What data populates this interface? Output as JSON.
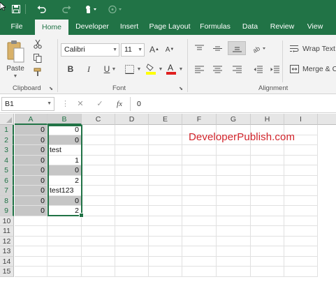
{
  "toolbar": {
    "save_icon": "save-icon",
    "undo_icon": "undo-icon",
    "redo_icon": "redo-icon",
    "touch_mode_icon": "touch-mode-icon",
    "customize_icon": "customize-qat-icon"
  },
  "tabs": [
    "File",
    "Home",
    "Developer",
    "Insert",
    "Page Layout",
    "Formulas",
    "Data",
    "Review",
    "View"
  ],
  "active_tab": "Home",
  "ribbon": {
    "clipboard": {
      "paste_label": "Paste",
      "group_label": "Clipboard"
    },
    "font": {
      "font_name": "Calibri",
      "font_size": "11",
      "bold": "B",
      "italic": "I",
      "underline": "U",
      "group_label": "Font"
    },
    "alignment": {
      "wrap_text": "Wrap Text",
      "merge_center": "Merge & C",
      "group_label": "Alignment"
    }
  },
  "formula_bar": {
    "name_box": "B1",
    "cancel_symbol": "✕",
    "enter_symbol": "✓",
    "fx_label": "fx",
    "formula_value": "0"
  },
  "grid": {
    "columns": [
      "A",
      "B",
      "C",
      "D",
      "E",
      "F",
      "G",
      "H",
      "I"
    ],
    "selected_columns": [
      "A",
      "B"
    ],
    "rows": [
      "1",
      "2",
      "3",
      "4",
      "5",
      "6",
      "7",
      "8",
      "9",
      "10",
      "11",
      "12",
      "13",
      "14",
      "15"
    ],
    "selected_rows": [
      "1",
      "2",
      "3",
      "4",
      "5",
      "6",
      "7",
      "8",
      "9"
    ],
    "cells": [
      {
        "a": "0",
        "b": "0",
        "b_num": true,
        "b_shaded": false
      },
      {
        "a": "0",
        "b": "0",
        "b_num": true,
        "b_shaded": true
      },
      {
        "a": "0",
        "b": "test",
        "b_num": false,
        "b_shaded": false
      },
      {
        "a": "0",
        "b": "1",
        "b_num": true,
        "b_shaded": false
      },
      {
        "a": "0",
        "b": "0",
        "b_num": true,
        "b_shaded": true
      },
      {
        "a": "0",
        "b": "2",
        "b_num": true,
        "b_shaded": false
      },
      {
        "a": "0",
        "b": "test123",
        "b_num": false,
        "b_shaded": false
      },
      {
        "a": "0",
        "b": "0",
        "b_num": true,
        "b_shaded": true
      },
      {
        "a": "0",
        "b": "2",
        "b_num": true,
        "b_shaded": false
      }
    ]
  },
  "watermark": "DeveloperPublish.com",
  "colors": {
    "accent": "#217346",
    "watermark": "#d2232a",
    "selection_shade": "#c6c6c6"
  }
}
